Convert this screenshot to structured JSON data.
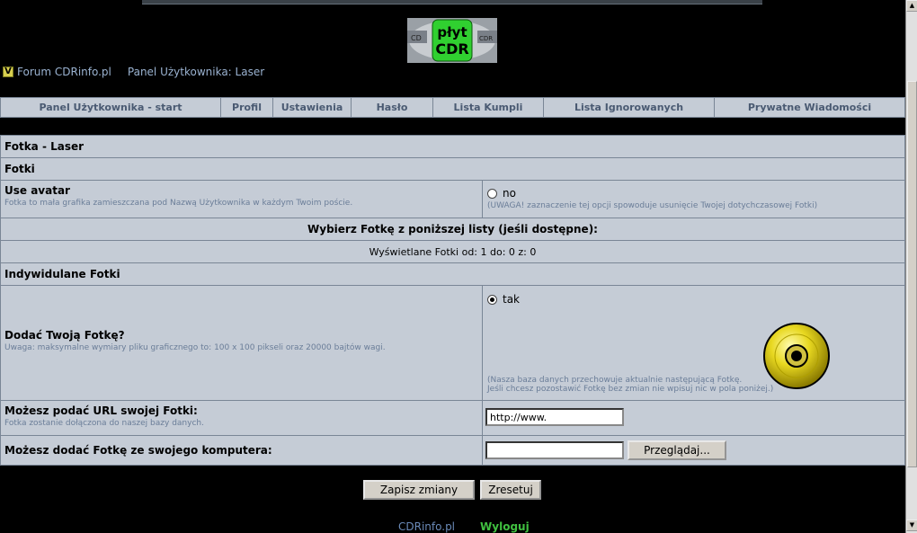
{
  "logo": {
    "line1": "płyt",
    "line2": "CDR",
    "left_tag": "CD",
    "right_tag": "CDR"
  },
  "nav": {
    "icon": "v-icon",
    "forum_link": "Forum CDRinfo.pl",
    "panel_text": "Panel Użytkownika: Laser"
  },
  "tabs": [
    {
      "label": "Panel Użytkownika - start"
    },
    {
      "label": "Profil"
    },
    {
      "label": "Ustawienia"
    },
    {
      "label": "Hasło"
    },
    {
      "label": "Lista Kumpli"
    },
    {
      "label": "Lista Ignorowanych"
    },
    {
      "label": "Prywatne Wiadomości"
    }
  ],
  "form": {
    "title": "Fotka - Laser",
    "section1": "Fotki",
    "avatar": {
      "label": "Use avatar",
      "desc": "Fotka to mała grafika zamieszczana pod Nazwą Użytkownika w każdym Twoim poście.",
      "option": "no",
      "note": "(UWAGA! zaznaczenie tej opcji spowoduje usunięcie Twojej dotychczasowej Fotki)"
    },
    "choose_header": "Wybierz Fotkę z poniższej listy (jeśli dostępne):",
    "shown_text": "Wyświetlane Fotki od: 1 do: 0 z: 0",
    "section2": "Indywidulane Fotki",
    "add": {
      "label": "Dodać Twoją Fotkę?",
      "desc": "Uwaga: maksymalne wymiary pliku graficznego to: 100 x 100 pikseli oraz 20000 bajtów wagi.",
      "option": "tak",
      "note1": "(Nasza baza danych przechowuje aktualnie następującą Fotkę.",
      "note2": "Jeśli chcesz pozostawić Fotkę bez zmian nie wpisuj nic w pola poniżej.)"
    },
    "url": {
      "label": "Możesz podać URL swojej Fotki:",
      "desc": "Fotka zostanie dołączona do naszej bazy danych.",
      "value": "http://www."
    },
    "upload": {
      "label": "Możesz dodać Fotkę ze swojego komputera:",
      "value": "",
      "browse": "Przeglądaj..."
    }
  },
  "buttons": {
    "save": "Zapisz zmiany",
    "reset": "Zresetuj"
  },
  "footer": {
    "site": "CDRinfo.pl",
    "logout": "Wyloguj"
  }
}
